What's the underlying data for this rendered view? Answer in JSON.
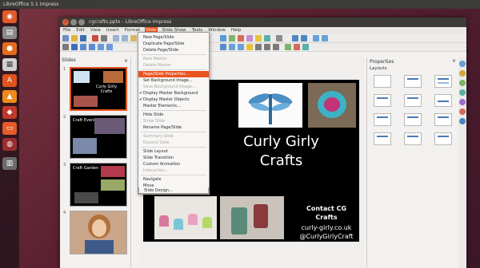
{
  "os": {
    "top_title": "LibreOffice 5.1 Impress"
  },
  "window": {
    "title": "cgcrafts.pptx - LibreOffice Impress"
  },
  "menubar": [
    "File",
    "Edit",
    "View",
    "Insert",
    "Format",
    "Slide",
    "Slide Show",
    "Tools",
    "Window",
    "Help"
  ],
  "slides_pane": {
    "header": "Slides",
    "numbers": [
      "1",
      "2",
      "3",
      "4"
    ],
    "thumb1_title": "Curly Girly Crafts",
    "thumb2_title": "Craft Evening",
    "thumb3_title": "Craft Garden"
  },
  "slide": {
    "title_line1": "Curly Girly",
    "title_line2": "Crafts",
    "contact_line1": "Contact CG",
    "contact_line2": "Crafts",
    "contact_line3": "curly-girly.co.uk",
    "contact_line4": "@CurlyGirlyCraft"
  },
  "properties": {
    "header": "Properties",
    "section": "Layouts"
  },
  "slide_menu": {
    "items": [
      {
        "label": "New Page/Slide",
        "state": "normal"
      },
      {
        "label": "Duplicate Page/Slide",
        "state": "normal"
      },
      {
        "label": "Delete Page/Slide",
        "state": "normal"
      },
      {
        "label": "New Master",
        "state": "disabled"
      },
      {
        "label": "Delete Master",
        "state": "disabled"
      },
      {
        "label": "Page/Slide Properties...",
        "state": "highlighted"
      },
      {
        "label": "Set Background Image...",
        "state": "normal"
      },
      {
        "label": "Save Background Image...",
        "state": "disabled"
      },
      {
        "label": "Display Master Background",
        "state": "checked"
      },
      {
        "label": "Display Master Objects",
        "state": "checked"
      },
      {
        "label": "Master Elements...",
        "state": "normal"
      },
      {
        "label": "Hide Slide",
        "state": "normal"
      },
      {
        "label": "Show Slide",
        "state": "disabled"
      },
      {
        "label": "Rename Page/Slide",
        "state": "normal"
      },
      {
        "label": "Summary Slide",
        "state": "disabled"
      },
      {
        "label": "Expand Slide",
        "state": "disabled"
      },
      {
        "label": "Slide Layout",
        "state": "normal"
      },
      {
        "label": "Slide Transition",
        "state": "normal"
      },
      {
        "label": "Custom Animation",
        "state": "normal"
      },
      {
        "label": "Interaction...",
        "state": "disabled"
      },
      {
        "label": "Navigate",
        "state": "normal"
      },
      {
        "label": "Move",
        "state": "normal"
      },
      {
        "label": "Slide Design...",
        "state": "normal"
      }
    ]
  },
  "colors": {
    "accent": "#e95420"
  }
}
